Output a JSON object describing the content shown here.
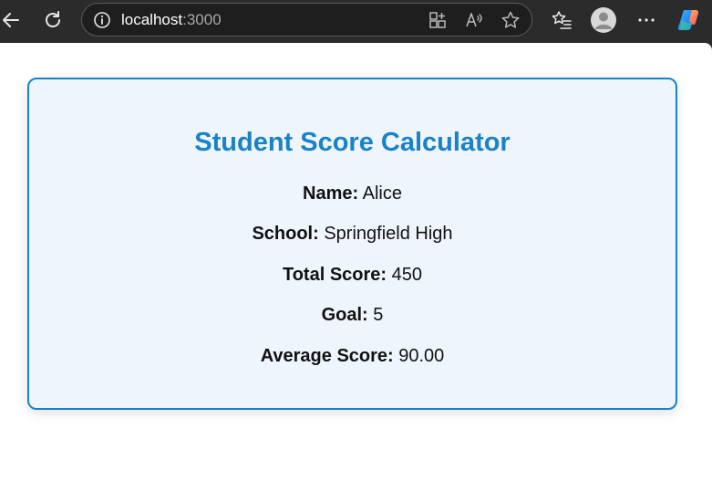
{
  "browser": {
    "url_host": "localhost",
    "url_port": ":3000",
    "icons": [
      "back-arrow-icon",
      "refresh-icon",
      "info-icon",
      "apps-grid-icon",
      "read-aloud-icon",
      "favorite-star-icon",
      "favorites-list-icon",
      "profile-avatar-icon",
      "more-dots-icon",
      "copilot-icon"
    ]
  },
  "page": {
    "title": "Student Score Calculator",
    "fields": [
      {
        "label": "Name:",
        "value": "Alice"
      },
      {
        "label": "School:",
        "value": "Springfield High"
      },
      {
        "label": "Total Score:",
        "value": "450"
      },
      {
        "label": "Goal:",
        "value": "5"
      },
      {
        "label": "Average Score:",
        "value": "90.00"
      }
    ]
  },
  "colors": {
    "accent": "#1a82c6",
    "card_background": "#eef5fc",
    "browser_chrome": "#2b2b2b"
  }
}
